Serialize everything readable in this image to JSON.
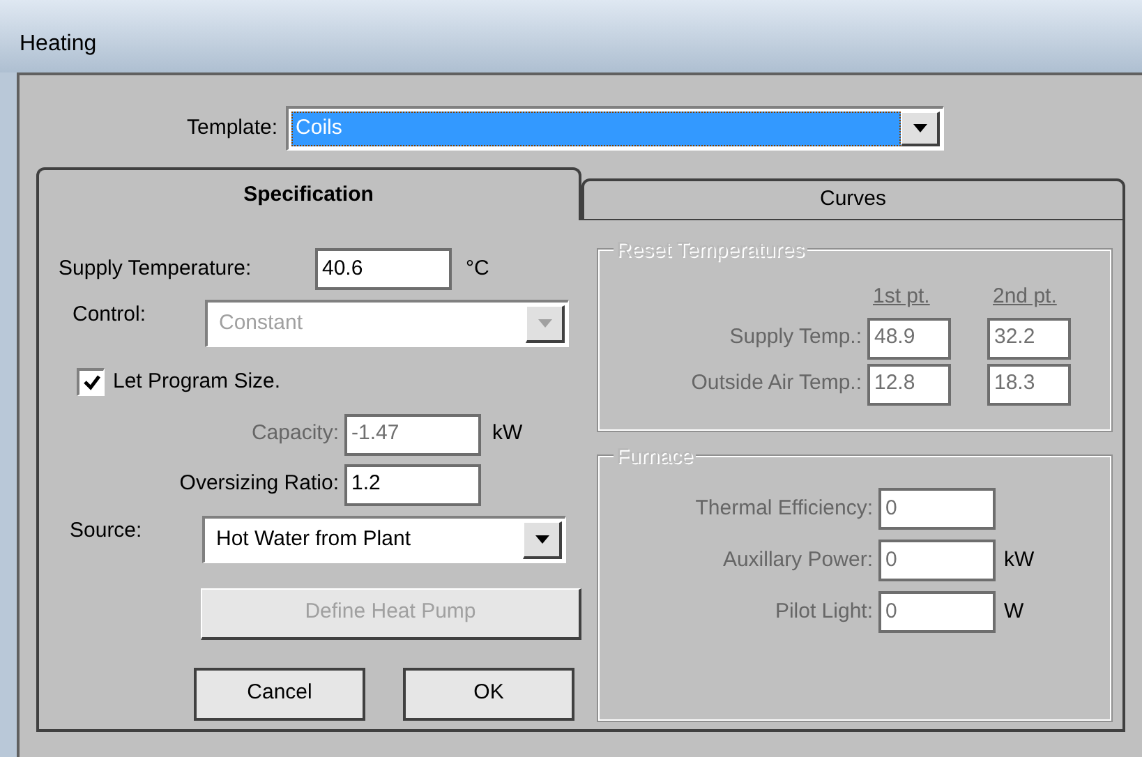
{
  "window": {
    "title": "Heating"
  },
  "template": {
    "label": "Template:",
    "value": "Coils"
  },
  "tabs": [
    {
      "label": "Specification",
      "selected": true
    },
    {
      "label": "Curves",
      "selected": false
    }
  ],
  "specification": {
    "supply_temperature": {
      "label": "Supply Temperature:",
      "value": "40.6",
      "unit": "°C"
    },
    "control": {
      "label": "Control:",
      "value": "Constant",
      "disabled": true
    },
    "let_program_size": {
      "label": "Let Program Size.",
      "checked": true
    },
    "capacity": {
      "label": "Capacity:",
      "value": "-1.47",
      "unit": "kW",
      "disabled": true
    },
    "oversizing_ratio": {
      "label": "Oversizing Ratio:",
      "value": "1.2"
    },
    "source": {
      "label": "Source:",
      "value": "Hot Water from Plant",
      "disabled": false
    },
    "define_heat_pump": {
      "label": "Define Heat Pump",
      "disabled": true
    },
    "buttons": [
      {
        "label": "Cancel"
      },
      {
        "label": "OK"
      }
    ]
  },
  "reset_temperatures": {
    "title": "Reset Temperatures",
    "disabled": true,
    "columns": [
      "1st pt.",
      "2nd pt."
    ],
    "rows": [
      {
        "label": "Supply Temp.:",
        "values": [
          "48.9",
          "32.2"
        ]
      },
      {
        "label": "Outside Air Temp.:",
        "values": [
          "12.8",
          "18.3"
        ]
      }
    ]
  },
  "furnace": {
    "title": "Furnace",
    "disabled": true,
    "fields": [
      {
        "label": "Thermal Efficiency:",
        "value": "0"
      },
      {
        "label": "Auxillary Power:",
        "value": "0",
        "unit": "kW"
      },
      {
        "label": "Pilot Light:",
        "value": "0",
        "unit": "W"
      }
    ]
  }
}
